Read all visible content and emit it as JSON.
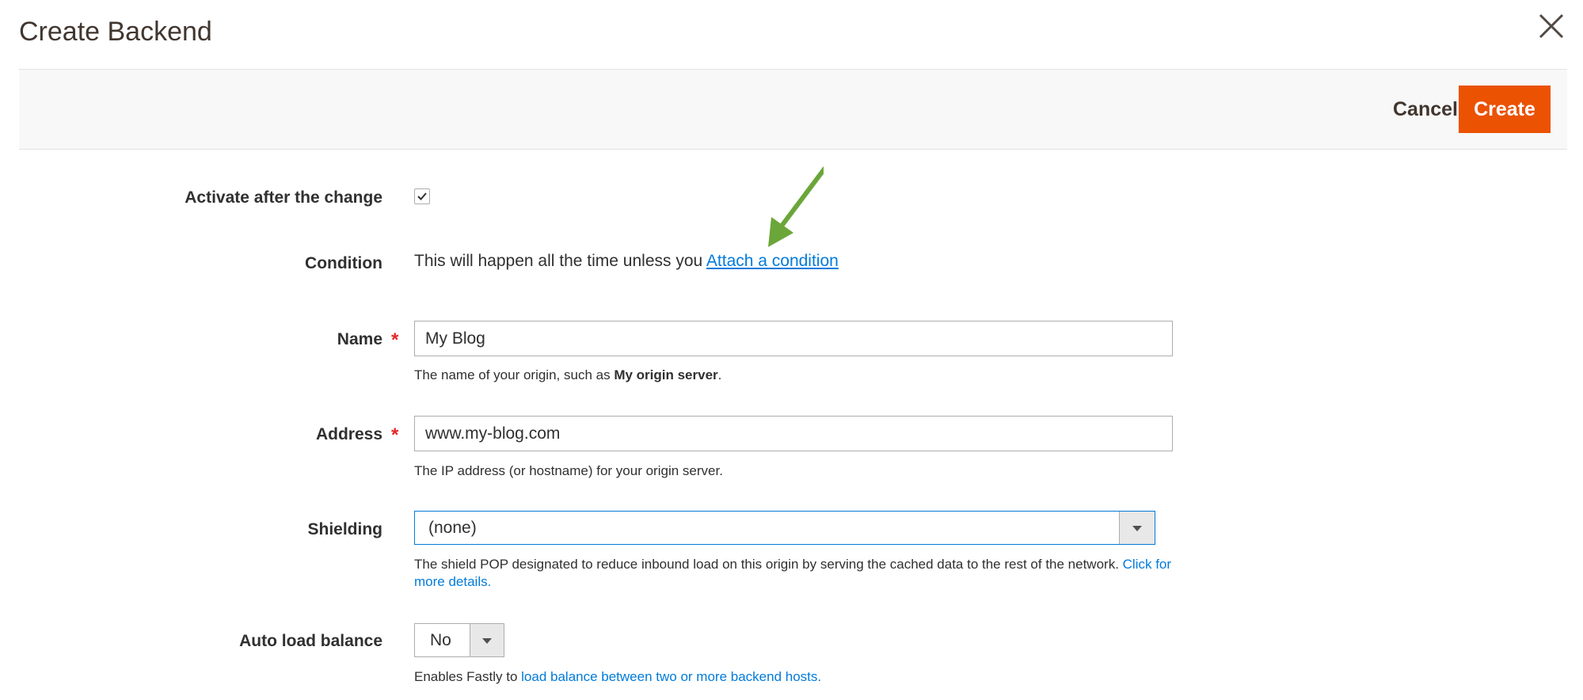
{
  "modal": {
    "title": "Create Backend"
  },
  "toolbar": {
    "cancel_label": "Cancel",
    "create_label": "Create",
    "accent_color": "#eb5202"
  },
  "form": {
    "activate": {
      "label": "Activate after the change",
      "checked": true
    },
    "condition": {
      "label": "Condition",
      "text": "This will happen all the time unless you",
      "link": "Attach a condition"
    },
    "name": {
      "label": "Name",
      "required_mark": "*",
      "value": "My Blog",
      "note_prefix": "The name of your origin, such as",
      "note_bold": "My origin server",
      "note_suffix": "."
    },
    "address": {
      "label": "Address",
      "required_mark": "*",
      "value": "www.my-blog.com",
      "note": "The IP address (or hostname) for your origin server."
    },
    "shielding": {
      "label": "Shielding",
      "selected": "(none)",
      "note_line1": "The shield POP designated to reduce inbound load on this origin by serving the cached data to the rest of the network.",
      "note_link1": "Click for",
      "note_link2": "more details."
    },
    "auto_load_balance": {
      "label": "Auto load balance",
      "selected": "No",
      "note_prefix": "Enables Fastly to",
      "note_link": "load balance between two or more backend hosts."
    }
  },
  "icons": {
    "close": "close-icon",
    "check": "check-icon",
    "dropdown": "chevron-down-icon",
    "annotation": "arrow-annotation-icon"
  },
  "colors": {
    "link": "#007bdb",
    "required": "#e22626",
    "annotation_arrow": "#6ba63a"
  }
}
